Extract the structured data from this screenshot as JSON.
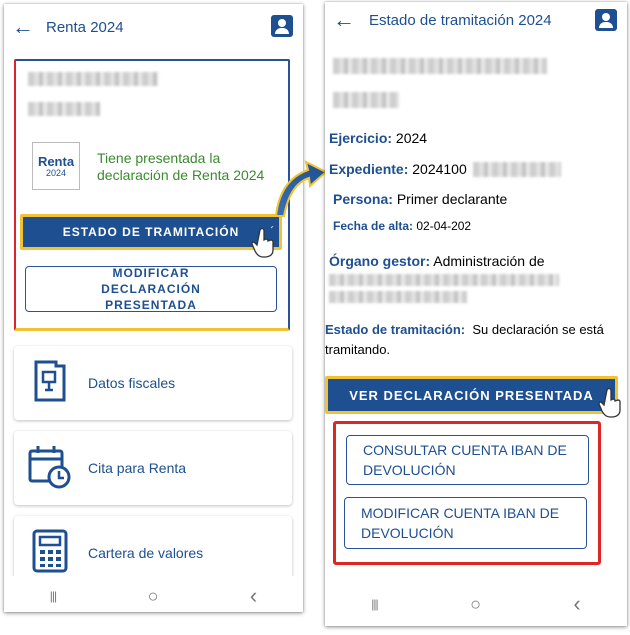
{
  "left_phone": {
    "header": {
      "title": "Renta 2024",
      "back_icon": "arrow-left-icon",
      "user_icon": "account-icon"
    },
    "logo": {
      "line1": "Renta",
      "line2": "2024"
    },
    "status_message": "Tiene presentada la declaración de Renta 2024",
    "status_button_label": "ESTADO DE TRAMITACIÓN",
    "modify_button_label": "MODIFICAR DECLARACIÓN PRESENTADA",
    "menu": [
      {
        "label": "Datos fiscales",
        "icon": "document-icon"
      },
      {
        "label": "Cita para Renta",
        "icon": "calendar-clock-icon"
      },
      {
        "label": "Cartera de valores",
        "icon": "calculator-icon"
      }
    ],
    "navbar": {
      "recents": "|||",
      "home": "○",
      "back": "‹"
    }
  },
  "right_phone": {
    "header": {
      "title": "Estado de tramitación",
      "year": "2024",
      "back_icon": "arrow-left-icon",
      "user_icon": "account-icon"
    },
    "ejercicio": {
      "label": "Ejercicio:",
      "value": "2024"
    },
    "expediente": {
      "label": "Expediente:",
      "value": "2024100"
    },
    "persona": {
      "label": "Persona:",
      "value": "Primer declarante"
    },
    "fecha_alta": {
      "label": "Fecha de alta:",
      "value": "02-04-202"
    },
    "organo": {
      "label": "Órgano gestor:",
      "value": "Administración de"
    },
    "estado": {
      "label": "Estado de tramitación:",
      "value": "Su declaración se está tramitando."
    },
    "ver_button_label": "VER DECLARACIÓN PRESENTADA",
    "consultar_button_label": "CONSULTAR CUENTA IBAN DE DEVOLUCIÓN",
    "modificar_iban_button_label": "MODIFICAR CUENTA IBAN DE DEVOLUCIÓN",
    "navbar": {
      "recents": "|||",
      "home": "○",
      "back": "‹"
    }
  },
  "colors": {
    "brand_blue": "#1d4f91",
    "highlight_yellow": "#f1c232",
    "alert_red": "#e02525",
    "success_green": "#3a8a2e"
  }
}
